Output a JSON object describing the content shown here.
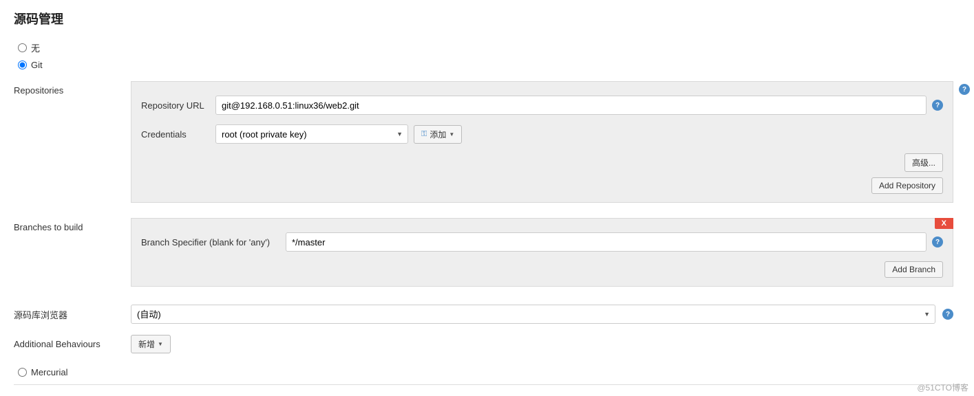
{
  "page": {
    "title": "源码管理"
  },
  "scm_options": {
    "none": "无",
    "git": "Git",
    "mercurial": "Mercurial"
  },
  "repositories": {
    "section_label": "Repositories",
    "url_label": "Repository URL",
    "url_value": "git@192.168.0.51:linux36/web2.git",
    "credentials_label": "Credentials",
    "credentials_selected": "root (root private key)",
    "add_button": "添加",
    "advanced_button": "高级...",
    "add_repo_button": "Add Repository"
  },
  "branches": {
    "section_label": "Branches to build",
    "specifier_label": "Branch Specifier (blank for 'any')",
    "specifier_value": "*/master",
    "add_branch_button": "Add Branch",
    "delete_label": "X"
  },
  "browser": {
    "label": "源码库浏览器",
    "selected": "(自动)"
  },
  "behaviours": {
    "label": "Additional Behaviours",
    "add_button": "新增"
  },
  "watermark": "@51CTO博客"
}
